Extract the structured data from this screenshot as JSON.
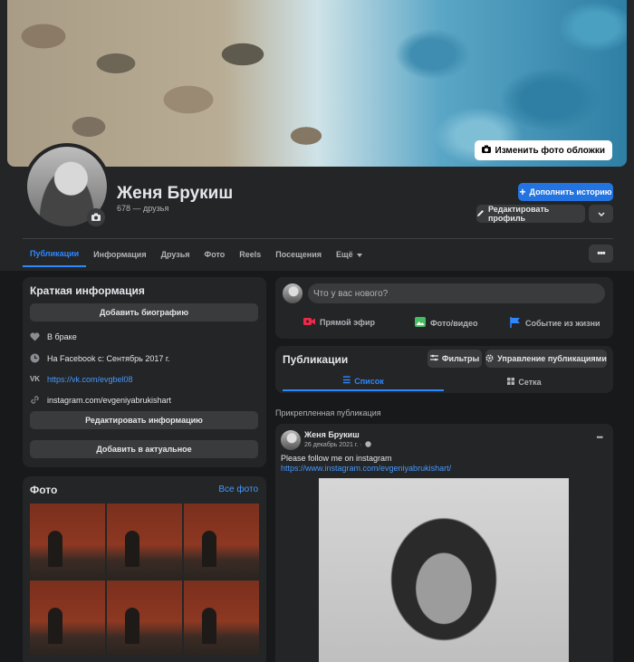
{
  "cover": {
    "edit_label": "Изменить фото обложки"
  },
  "profile": {
    "name": "Женя Брукиш",
    "friends": "678 — друзья"
  },
  "actions": {
    "add_story": "Дополнить историю",
    "edit_profile": "Редактировать профиль"
  },
  "tabs": [
    "Публикации",
    "Информация",
    "Друзья",
    "Фото",
    "Reels",
    "Посещения",
    "Ещё"
  ],
  "intro": {
    "title": "Краткая информация",
    "add_bio": "Добавить биографию",
    "relationship": "В браке",
    "joined": "На Facebook с: Сентябрь 2017 г.",
    "vk": "https://vk.com/evgbel08",
    "instagram": "instagram.com/evgeniyabrukishart",
    "edit_info": "Редактировать информацию",
    "add_featured": "Добавить в актуальное"
  },
  "photos": {
    "title": "Фото",
    "see_all": "Все фото"
  },
  "composer": {
    "placeholder": "Что у вас нового?",
    "live": "Прямой эфир",
    "photo_video": "Фото/видео",
    "life_event": "Событие из жизни"
  },
  "posts_header": {
    "title": "Публикации",
    "filters": "Фильтры",
    "manage": "Управление публикациями",
    "list_view": "Список",
    "grid_view": "Сетка"
  },
  "pinned": {
    "label": "Прикрепленная публикация",
    "author": "Женя Брукиш",
    "date": "26 декабрь 2021 г. ·",
    "text": "Please follow me on instagram",
    "link": "https://www.instagram.com/evgeniyabrukishart/"
  },
  "colors": {
    "accent": "#2374e1",
    "bg": "#18191a",
    "card": "#242526",
    "button": "#3a3b3c"
  }
}
